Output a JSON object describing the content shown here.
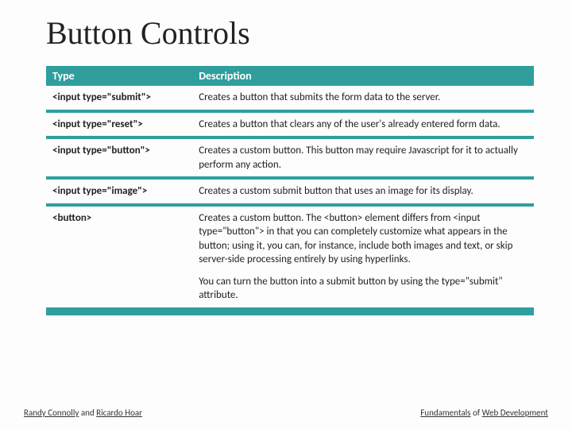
{
  "title": "Button Controls",
  "headers": {
    "type": "Type",
    "desc": "Description"
  },
  "rows": [
    {
      "type": "<input type=\"submit\">",
      "desc": "Creates a button that submits the form data to the server."
    },
    {
      "type": "<input type=\"reset\">",
      "desc": "Creates a button that clears any of the user's already entered form data."
    },
    {
      "type": "<input type=\"button\">",
      "desc": "Creates a custom button. This button may require Javascript for it to actually perform any action."
    },
    {
      "type": "<input type=\"image\">",
      "desc": "Creates a custom submit button that uses an image for its display."
    },
    {
      "type": "<button>",
      "desc": "Creates a custom button. The <button> element differs from <input type=\"button\"> in that you can completely customize what appears in the button; using it, you can, for instance, include both images and text, or skip server-side processing entirely by using hyperlinks.",
      "desc2": "You can turn the button into a submit button by using the type=\"submit\" attribute."
    }
  ],
  "footer": {
    "left_a": "Randy Connolly",
    "left_mid": " and ",
    "left_b": "Ricardo Hoar",
    "right_a": "Fundamentals",
    "right_mid": " of ",
    "right_b": "Web Development"
  }
}
